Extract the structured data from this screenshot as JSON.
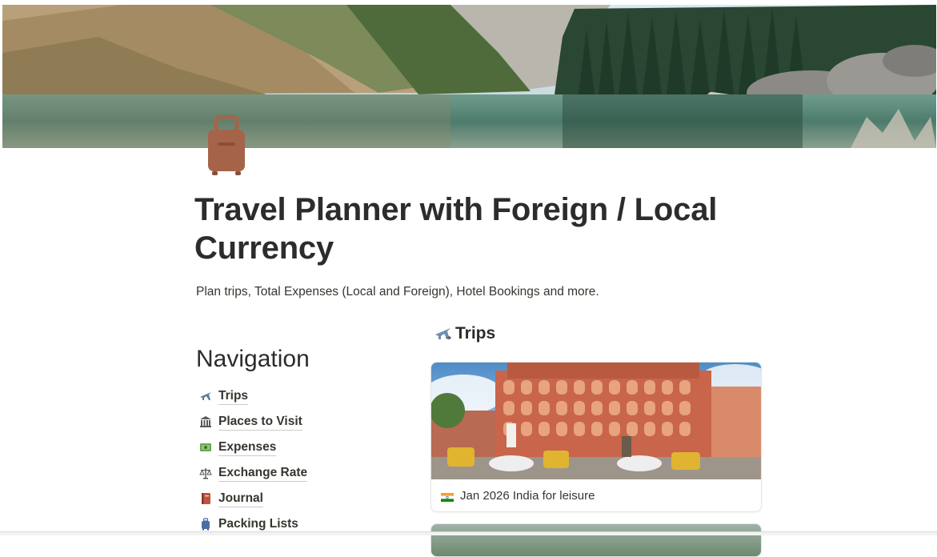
{
  "page": {
    "title": "Travel Planner with Foreign / Local Currency",
    "subtitle": "Plan trips, Total Expenses (Local and Foreign), Hotel Bookings and more.",
    "icon": "luggage-icon"
  },
  "navigation": {
    "heading": "Navigation",
    "items": [
      {
        "label": "Trips",
        "icon": "airplane-icon"
      },
      {
        "label": "Places to Visit",
        "icon": "classical-building-icon"
      },
      {
        "label": "Expenses",
        "icon": "money-bills-icon"
      },
      {
        "label": "Exchange Rate",
        "icon": "scales-icon"
      },
      {
        "label": "Journal",
        "icon": "notebook-icon"
      },
      {
        "label": "Packing Lists",
        "icon": "luggage-icon"
      }
    ]
  },
  "trips": {
    "heading": "Trips",
    "icon": "airplane-icon",
    "cards": [
      {
        "title": "Jan 2026 India for leisure",
        "flag": "india-flag-icon"
      }
    ]
  },
  "colors": {
    "accent_luggage": "#a5644a",
    "text": "#37352f"
  }
}
